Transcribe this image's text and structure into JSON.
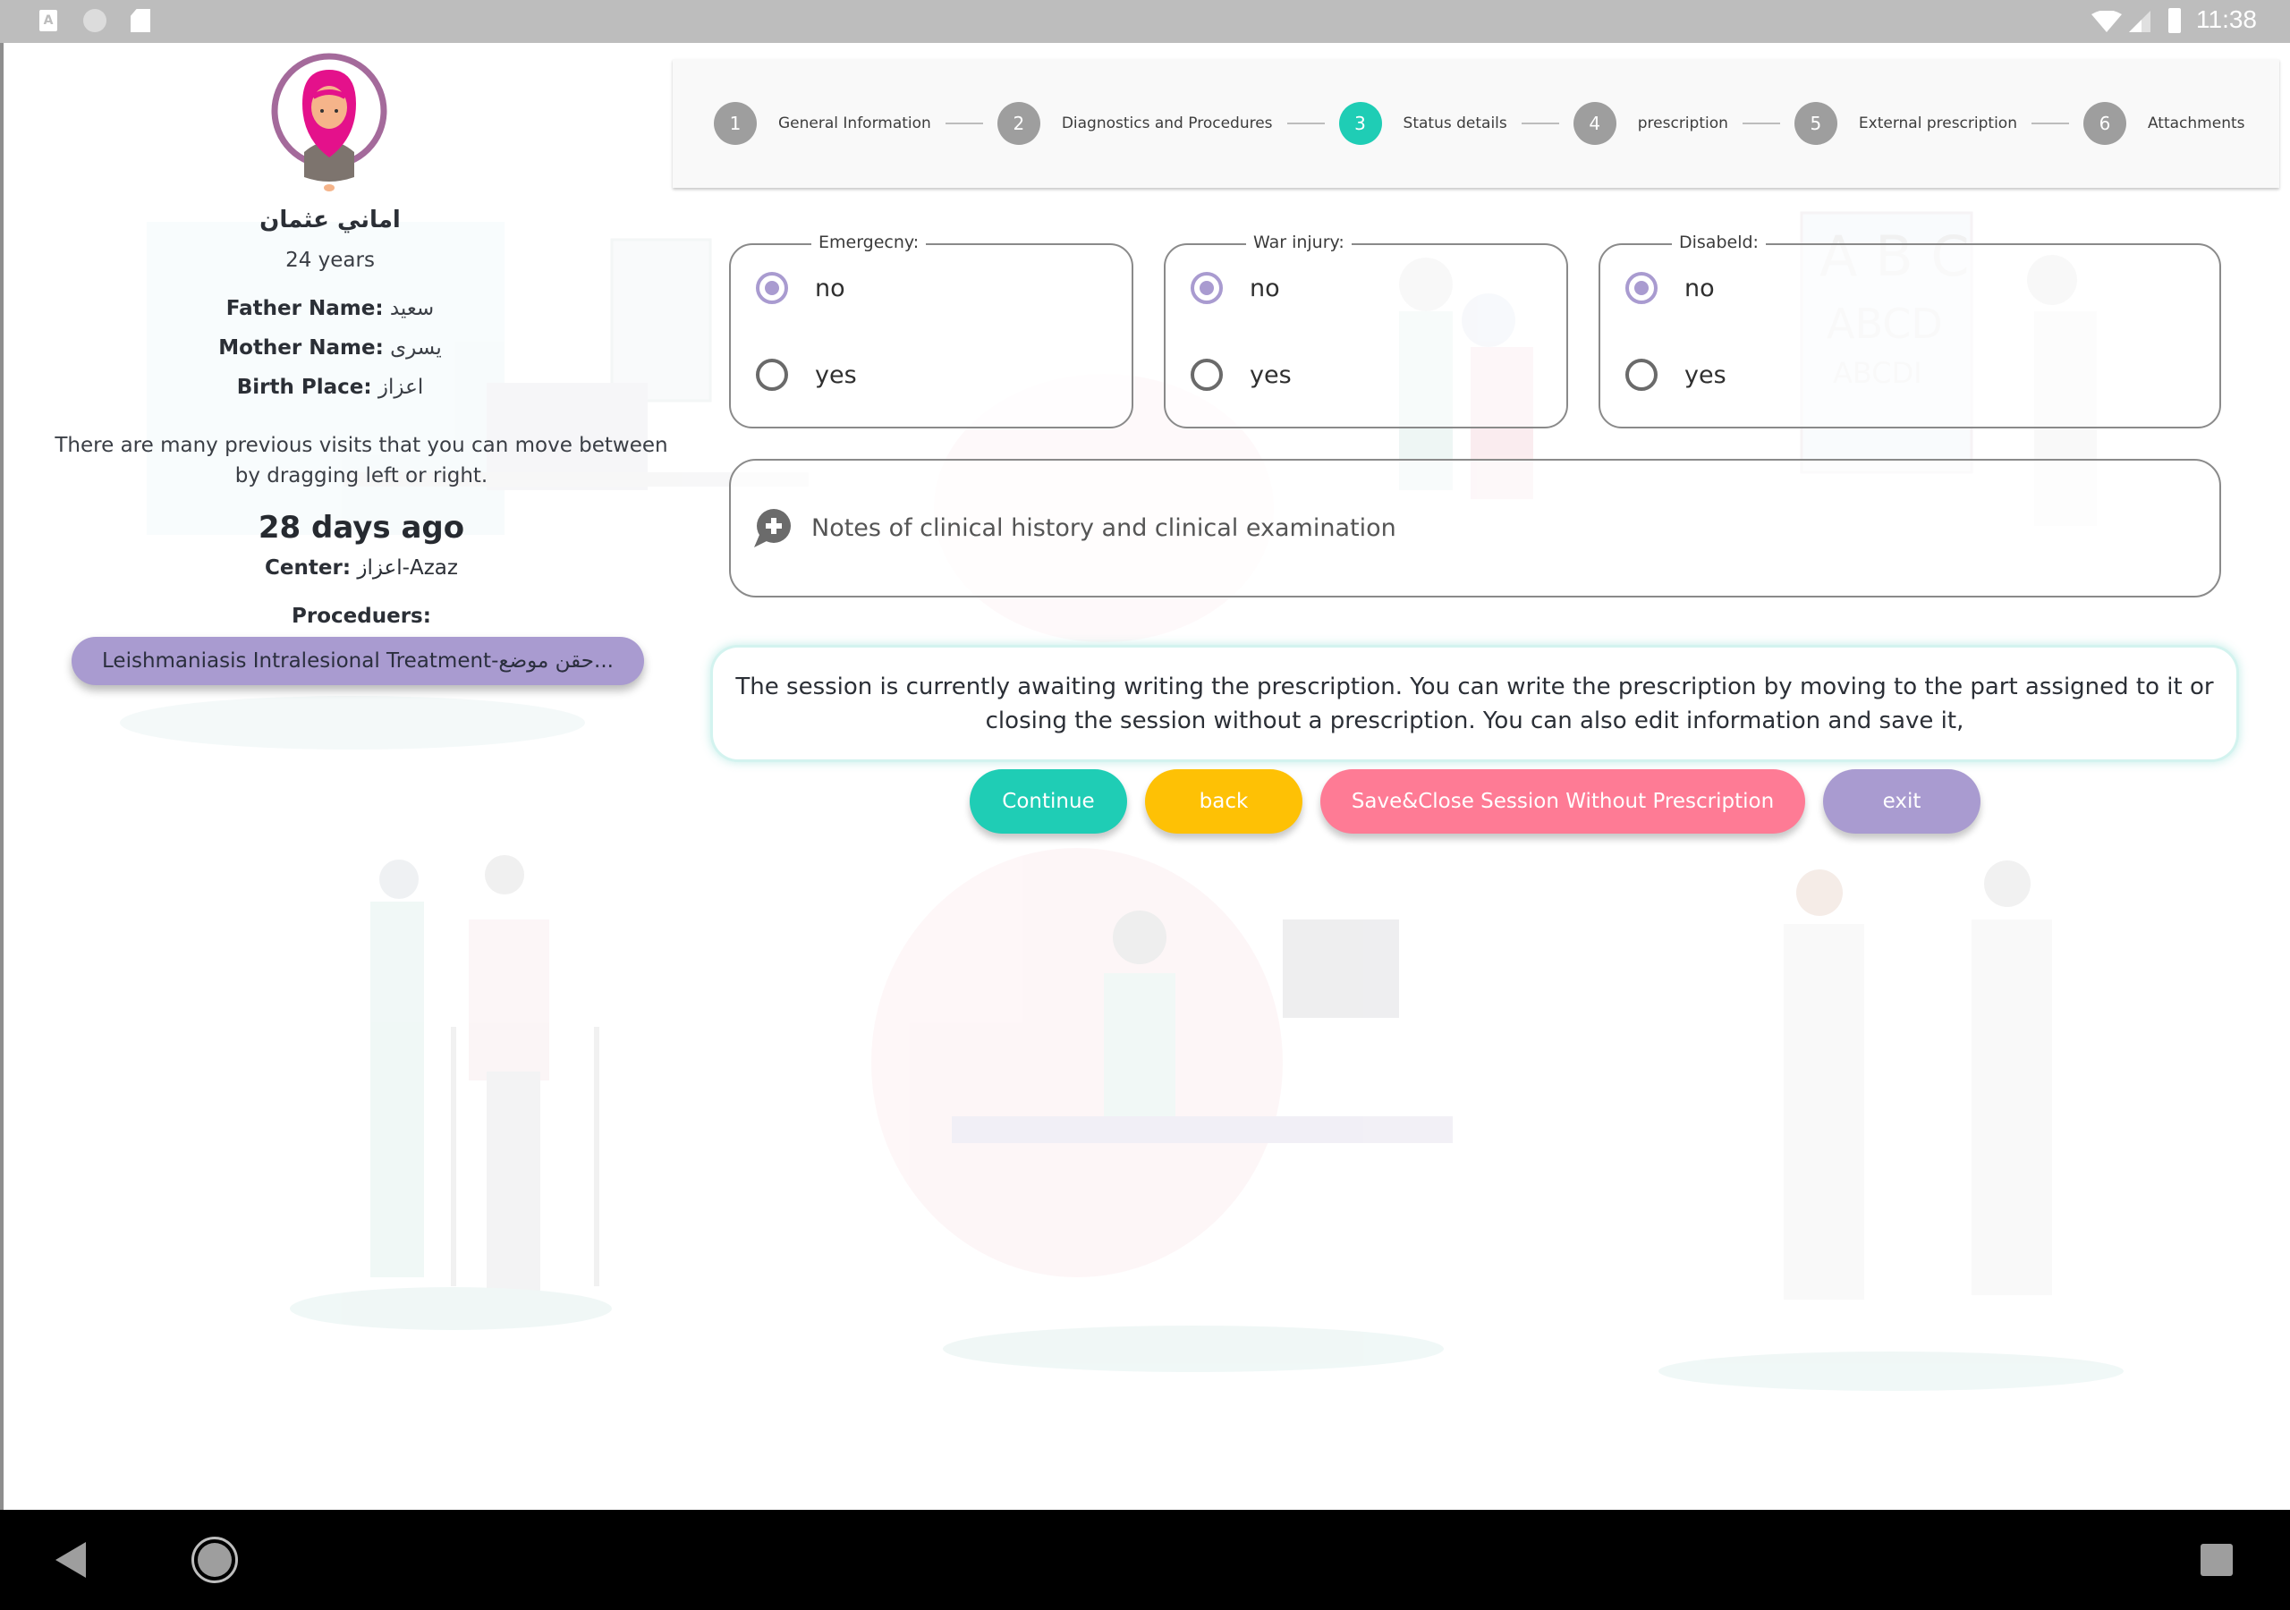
{
  "status_bar": {
    "time": "11:38",
    "left_icons": [
      "accessibility-a-icon",
      "sync-icon",
      "sd-card-icon"
    ],
    "right_icons": [
      "wifi-icon",
      "cell-signal-icon",
      "battery-icon"
    ]
  },
  "patient": {
    "name": "اماني عثمان",
    "age": "24 years",
    "father_label": "Father Name:",
    "father_value": "سعيد",
    "mother_label": "Mother Name:",
    "mother_value": "يسرى",
    "birthplace_label": "Birth Place:",
    "birthplace_value": "اعزاز",
    "visits_hint": "There are many previous visits that you can move between by dragging left or right.",
    "visit_when": "28 days ago",
    "center_label": "Center:",
    "center_value": "اعزاز-Azaz",
    "procedures_label": "Proceduers:",
    "procedures": [
      "Leishmaniasis Intralesional Treatment-حقن موضع..."
    ]
  },
  "stepper": {
    "active_step": 3,
    "steps": [
      {
        "num": "1",
        "label": "General Information"
      },
      {
        "num": "2",
        "label": "Diagnostics and Procedures"
      },
      {
        "num": "3",
        "label": "Status details"
      },
      {
        "num": "4",
        "label": "prescription"
      },
      {
        "num": "5",
        "label": "External prescription"
      },
      {
        "num": "6",
        "label": "Attachments"
      }
    ]
  },
  "status_form": {
    "groups": [
      {
        "legend": "Emergecny:",
        "options": [
          "no",
          "yes"
        ],
        "selected": "no"
      },
      {
        "legend": "War injury:",
        "options": [
          "no",
          "yes"
        ],
        "selected": "no"
      },
      {
        "legend": "Disabeld:",
        "options": [
          "no",
          "yes"
        ],
        "selected": "no"
      }
    ],
    "notes_placeholder": "Notes of clinical history and clinical examination"
  },
  "info_message": "The session is currently awaiting writing the prescription. You can write the prescription by moving to the part assigned to it or closing the session without a prescription. You can also edit information and save it,",
  "actions": {
    "continue": "Continue",
    "back": "back",
    "save_close": "Save&Close Session Without Prescription",
    "exit": "exit"
  },
  "colors": {
    "teal": "#1fcdb5",
    "yellow": "#fec105",
    "pink": "#fe7b95",
    "lavender": "#a99bd0",
    "step_inactive": "#9e9e9e"
  }
}
